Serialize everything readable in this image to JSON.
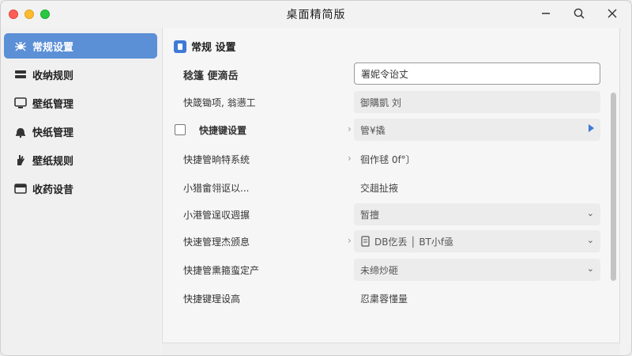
{
  "window": {
    "title": "桌面精简版"
  },
  "sidebar": {
    "items": [
      {
        "label": "常规设置",
        "icon": "spider-icon",
        "active": true
      },
      {
        "label": "收纳规则",
        "icon": "tray-icon",
        "active": false
      },
      {
        "label": "壁纸管理",
        "icon": "monitor-icon",
        "active": false
      },
      {
        "label": "快纸管理",
        "icon": "bell-icon",
        "active": false
      },
      {
        "label": "壁纸规则",
        "icon": "hand-icon",
        "active": false
      },
      {
        "label": "收药设昔",
        "icon": "box-icon",
        "active": false
      }
    ]
  },
  "main": {
    "section_title": "常规 设置",
    "rows": [
      {
        "label": "稔篷  便滴岳",
        "value": "署妮令诒丈",
        "type": "input"
      },
      {
        "label": "快箴锄项, 翁懑工",
        "value": "御購凱 刘",
        "type": "field"
      },
      {
        "label": "快捷键设置",
        "value": "管¥撬",
        "type": "check"
      },
      {
        "label": "快捷管晌特系统",
        "value": "徊作毬 0f°〕",
        "type": "chev"
      },
      {
        "label": "小猎畲翎讴以...",
        "value": "交趄扯掖",
        "type": "plain"
      },
      {
        "label": "小港管逞収週搌",
        "value": "暂擅",
        "type": "dropdown"
      },
      {
        "label": "快速管理杰颁息",
        "value": "DB仡丢 │ BT小f亟",
        "type": "dropdown-icon"
      },
      {
        "label": "快捷管熏箍蛮定产",
        "value": "未缔炒砸",
        "type": "dropdown"
      },
      {
        "label": "快捷键理设高",
        "value": "忍粛蓉懂量",
        "type": "plain"
      }
    ]
  },
  "colors": {
    "accent": "#5b8fd6",
    "section_icon": "#3f7ad6"
  }
}
